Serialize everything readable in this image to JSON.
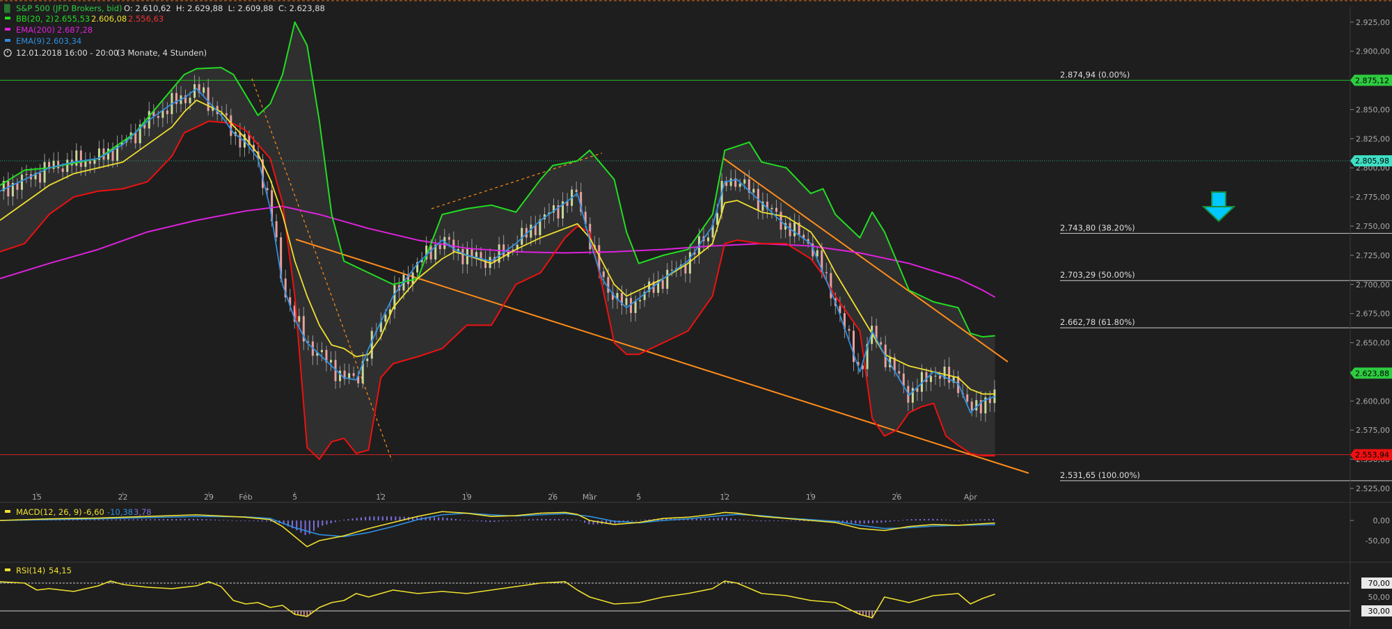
{
  "header": {
    "title": "S&P 500 (JFD Brokers, bid)",
    "ohlc": "O: 2.610,62  H: 2.629,88  L: 2.609,88  C: 2.623,88",
    "bb_label": "BB(20, 2)",
    "bb_values": [
      "2.655,53",
      "2.606,08",
      "2.556,63"
    ],
    "ema200_label": "EMA(200)",
    "ema200_value": "2.687,28",
    "ema9_label": "EMA(9)",
    "ema9_value": "2.603,34",
    "timestamp": "12.01.2018 16:00 - 20:00",
    "range": "(3 Monate, 4 Stunden)"
  },
  "fib_levels": [
    {
      "label": "2.874,94 (0.00%)",
      "price": 2874.94
    },
    {
      "label": "2.743,80 (38.20%)",
      "price": 2743.8
    },
    {
      "label": "2.703,29 (50.00%)",
      "price": 2703.29
    },
    {
      "label": "2.662,78 (61.80%)",
      "price": 2662.78
    },
    {
      "label": "2.531,65 (100.00%)",
      "price": 2531.65
    }
  ],
  "price_badges": [
    {
      "label": "2.875,12",
      "price": 2875.12,
      "color": "#2ecc40",
      "text_color": "#000000"
    },
    {
      "label": "2.805,98",
      "price": 2805.98,
      "color": "#3fe0c5",
      "text_color": "#000000"
    },
    {
      "label": "2.623,88",
      "price": 2623.88,
      "color": "#2ecc40",
      "text_color": "#000000"
    },
    {
      "label": "2.553,94",
      "price": 2553.94,
      "color": "#ee1111",
      "text_color": "#000000"
    }
  ],
  "macd_panel": {
    "label": "MACD(12, 26, 9)",
    "values": [
      "-6,60",
      "-10,38",
      "3,78"
    ],
    "axis_labels": [
      "0,00",
      "-50,00"
    ]
  },
  "rsi_panel": {
    "label": "RSI(14)",
    "value": "54,15",
    "levels": [
      "70,00",
      "50,00",
      "30,00"
    ]
  },
  "colors": {
    "background": "#1e1e1e",
    "bb_upper": "#22dd22",
    "bb_lower": "#ee1111",
    "bb_mid": "#f0e030",
    "ema200": "#dd22dd",
    "ema9": "#2f8fdf",
    "trend": "#ff8c1a",
    "resistance_line": "#22bb22",
    "support_line": "#cc2222",
    "pivot_line": "#2aaa88",
    "macd_hist": "#7b6fe0",
    "macd_line": "#f0e030",
    "signal_line": "#2f8fdf",
    "arrow": "#00c8ff"
  },
  "chart_data": {
    "type": "line",
    "title": "S&P 500 (JFD Brokers, bid)",
    "ylim": [
      2525,
      2935
    ],
    "x_tick_labels": [
      "15",
      "22",
      "29",
      "Feb",
      "5",
      "12",
      "19",
      "26",
      "Mär",
      "5",
      "12",
      "19",
      "26",
      "Apr"
    ],
    "y_tick_labels": [
      "2.925,00",
      "2.900,00",
      "2.875,00",
      "2.850,00",
      "2.825,00",
      "2.800,00",
      "2.775,00",
      "2.750,00",
      "2.725,00",
      "2.700,00",
      "2.675,00",
      "2.650,00",
      "2.625,00",
      "2.600,00",
      "2.575,00",
      "2.550,00",
      "2.525,00"
    ],
    "y_tick_values": [
      2925,
      2900,
      2875,
      2850,
      2825,
      2800,
      2775,
      2750,
      2725,
      2700,
      2675,
      2650,
      2625,
      2600,
      2575,
      2550,
      2525
    ],
    "x_tick_day": [
      3,
      10,
      17,
      20,
      24,
      31,
      38,
      45,
      48,
      52,
      59,
      66,
      73,
      79
    ],
    "series": [
      {
        "name": "BB(20, 2)",
        "role": "upper",
        "x": [
          0,
          2,
          4,
          8,
          11,
          13,
          15,
          16,
          18,
          19,
          21,
          22,
          23,
          24,
          25,
          26,
          27,
          28,
          30,
          32,
          34,
          36,
          38,
          40,
          42,
          44,
          45,
          47,
          48,
          50,
          51,
          52,
          54,
          56,
          58,
          59,
          61,
          62,
          64,
          66,
          67,
          68,
          70,
          71,
          72,
          73,
          74,
          75,
          76,
          78,
          79,
          80,
          81
        ],
        "y": [
          2785,
          2798,
          2800,
          2808,
          2830,
          2855,
          2880,
          2885,
          2886,
          2880,
          2845,
          2855,
          2880,
          2925,
          2905,
          2840,
          2760,
          2720,
          2710,
          2700,
          2705,
          2760,
          2765,
          2768,
          2762,
          2790,
          2802,
          2806,
          2815,
          2790,
          2745,
          2718,
          2725,
          2730,
          2760,
          2815,
          2822,
          2805,
          2800,
          2778,
          2782,
          2760,
          2740,
          2762,
          2745,
          2720,
          2695,
          2690,
          2685,
          2680,
          2658,
          2655,
          2656
        ]
      },
      {
        "name": "BB(20, 2)",
        "role": "lower",
        "x": [
          0,
          2,
          4,
          6,
          8,
          10,
          12,
          14,
          15,
          17,
          19,
          20,
          21,
          22,
          23,
          24,
          25,
          26,
          27,
          28,
          29,
          30,
          31,
          32,
          34,
          36,
          37,
          38,
          39,
          40,
          42,
          44,
          46,
          47,
          48,
          49,
          50,
          51,
          52,
          54,
          56,
          58,
          59,
          60,
          62,
          64,
          66,
          67,
          68,
          70,
          71,
          72,
          73,
          74,
          75,
          76,
          77,
          78,
          79,
          80,
          81
        ],
        "y": [
          2728,
          2735,
          2760,
          2775,
          2780,
          2782,
          2788,
          2810,
          2830,
          2840,
          2838,
          2832,
          2820,
          2808,
          2770,
          2690,
          2560,
          2550,
          2565,
          2568,
          2555,
          2558,
          2620,
          2632,
          2638,
          2645,
          2655,
          2665,
          2665,
          2665,
          2700,
          2710,
          2740,
          2750,
          2745,
          2700,
          2650,
          2640,
          2640,
          2650,
          2660,
          2690,
          2735,
          2738,
          2735,
          2735,
          2722,
          2708,
          2690,
          2660,
          2585,
          2570,
          2575,
          2590,
          2595,
          2598,
          2570,
          2562,
          2555,
          2553,
          2553
        ]
      },
      {
        "name": "BB(20, 2)",
        "role": "middle",
        "x": [
          0,
          2,
          4,
          6,
          8,
          10,
          12,
          14,
          15,
          16,
          18,
          19,
          20,
          21,
          22,
          23,
          24,
          25,
          26,
          27,
          28,
          29,
          30,
          31,
          32,
          34,
          36,
          37,
          38,
          40,
          42,
          44,
          46,
          47,
          48,
          49,
          50,
          51,
          52,
          54,
          56,
          58,
          59,
          60,
          62,
          64,
          66,
          67,
          68,
          70,
          72,
          74,
          76,
          78,
          79,
          80,
          81
        ],
        "y": [
          2755,
          2770,
          2785,
          2795,
          2800,
          2805,
          2820,
          2835,
          2848,
          2858,
          2848,
          2836,
          2825,
          2812,
          2790,
          2760,
          2720,
          2690,
          2665,
          2648,
          2645,
          2638,
          2640,
          2655,
          2680,
          2705,
          2722,
          2728,
          2725,
          2718,
          2730,
          2740,
          2748,
          2752,
          2740,
          2720,
          2700,
          2690,
          2695,
          2705,
          2718,
          2735,
          2770,
          2772,
          2762,
          2758,
          2745,
          2730,
          2710,
          2675,
          2640,
          2630,
          2625,
          2620,
          2610,
          2606,
          2606
        ]
      },
      {
        "name": "EMA(200)",
        "x": [
          0,
          4,
          8,
          12,
          16,
          20,
          23,
          26,
          30,
          34,
          38,
          42,
          46,
          50,
          54,
          58,
          62,
          66,
          70,
          74,
          78,
          80,
          81
        ],
        "y": [
          2705,
          2718,
          2730,
          2745,
          2755,
          2763,
          2767,
          2760,
          2748,
          2738,
          2731,
          2728,
          2727,
          2728,
          2730,
          2733,
          2735,
          2733,
          2727,
          2718,
          2705,
          2695,
          2689
        ]
      },
      {
        "name": "EMA(9)",
        "x": [
          0,
          2,
          4,
          6,
          8,
          10,
          12,
          14,
          15,
          16,
          18,
          19,
          20,
          21,
          22,
          23,
          24,
          25,
          26,
          27,
          28,
          29,
          30,
          31,
          32,
          34,
          36,
          37,
          38,
          40,
          42,
          44,
          46,
          47,
          48,
          49,
          50,
          51,
          52,
          54,
          56,
          58,
          59,
          60,
          62,
          64,
          66,
          67,
          68,
          70,
          71,
          72,
          74,
          76,
          78,
          79,
          80,
          81
        ],
        "y": [
          2780,
          2790,
          2800,
          2805,
          2808,
          2820,
          2840,
          2855,
          2860,
          2868,
          2845,
          2830,
          2822,
          2808,
          2765,
          2700,
          2670,
          2650,
          2640,
          2630,
          2620,
          2618,
          2645,
          2668,
          2690,
          2718,
          2738,
          2730,
          2725,
          2720,
          2735,
          2755,
          2770,
          2778,
          2738,
          2705,
          2690,
          2680,
          2688,
          2705,
          2720,
          2750,
          2788,
          2790,
          2770,
          2750,
          2735,
          2710,
          2685,
          2625,
          2660,
          2640,
          2605,
          2625,
          2615,
          2590,
          2600,
          2604
        ]
      },
      {
        "name": "MACD(12, 26, 9)",
        "role": "macd",
        "x": [
          0,
          4,
          8,
          12,
          16,
          20,
          22,
          23,
          24,
          25,
          26,
          28,
          30,
          32,
          34,
          36,
          38,
          40,
          42,
          44,
          46,
          47,
          48,
          50,
          52,
          54,
          56,
          58,
          59,
          60,
          62,
          64,
          66,
          68,
          70,
          72,
          74,
          76,
          78,
          80,
          81
        ],
        "y": [
          0,
          4,
          6,
          10,
          14,
          8,
          2,
          -15,
          -40,
          -65,
          -50,
          -38,
          -20,
          -5,
          10,
          22,
          18,
          10,
          12,
          18,
          20,
          15,
          0,
          -10,
          -5,
          5,
          8,
          15,
          20,
          18,
          10,
          5,
          0,
          -5,
          -20,
          -25,
          -15,
          -10,
          -12,
          -8,
          -6.6
        ]
      },
      {
        "name": "MACD(12, 26, 9)",
        "role": "signal",
        "x": [
          0,
          4,
          8,
          12,
          16,
          20,
          22,
          24,
          26,
          28,
          30,
          32,
          34,
          36,
          38,
          40,
          42,
          44,
          46,
          48,
          50,
          52,
          54,
          56,
          58,
          60,
          62,
          64,
          66,
          68,
          70,
          72,
          74,
          76,
          78,
          80,
          81
        ],
        "y": [
          0,
          2,
          4,
          7,
          10,
          9,
          5,
          -18,
          -35,
          -40,
          -30,
          -15,
          2,
          14,
          18,
          14,
          11,
          14,
          17,
          10,
          -2,
          -6,
          0,
          4,
          10,
          15,
          12,
          6,
          2,
          -2,
          -12,
          -20,
          -18,
          -14,
          -12,
          -11,
          -10.38
        ]
      },
      {
        "name": "RSI(14)",
        "x": [
          0,
          2,
          3,
          4,
          6,
          8,
          9,
          10,
          12,
          14,
          16,
          17,
          18,
          19,
          20,
          21,
          22,
          23,
          24,
          25,
          26,
          27,
          28,
          29,
          30,
          32,
          34,
          36,
          38,
          40,
          42,
          44,
          46,
          47,
          48,
          50,
          52,
          54,
          56,
          58,
          59,
          60,
          62,
          64,
          66,
          68,
          70,
          71,
          72,
          74,
          76,
          78,
          79,
          80,
          81
        ],
        "y": [
          72,
          70,
          60,
          62,
          58,
          66,
          73,
          68,
          64,
          62,
          66,
          72,
          65,
          45,
          40,
          42,
          35,
          38,
          25,
          22,
          35,
          42,
          45,
          55,
          50,
          60,
          55,
          58,
          55,
          60,
          65,
          70,
          72,
          60,
          50,
          40,
          42,
          50,
          55,
          62,
          73,
          70,
          55,
          52,
          45,
          42,
          25,
          20,
          50,
          42,
          52,
          55,
          40,
          48,
          54.15
        ]
      }
    ]
  }
}
